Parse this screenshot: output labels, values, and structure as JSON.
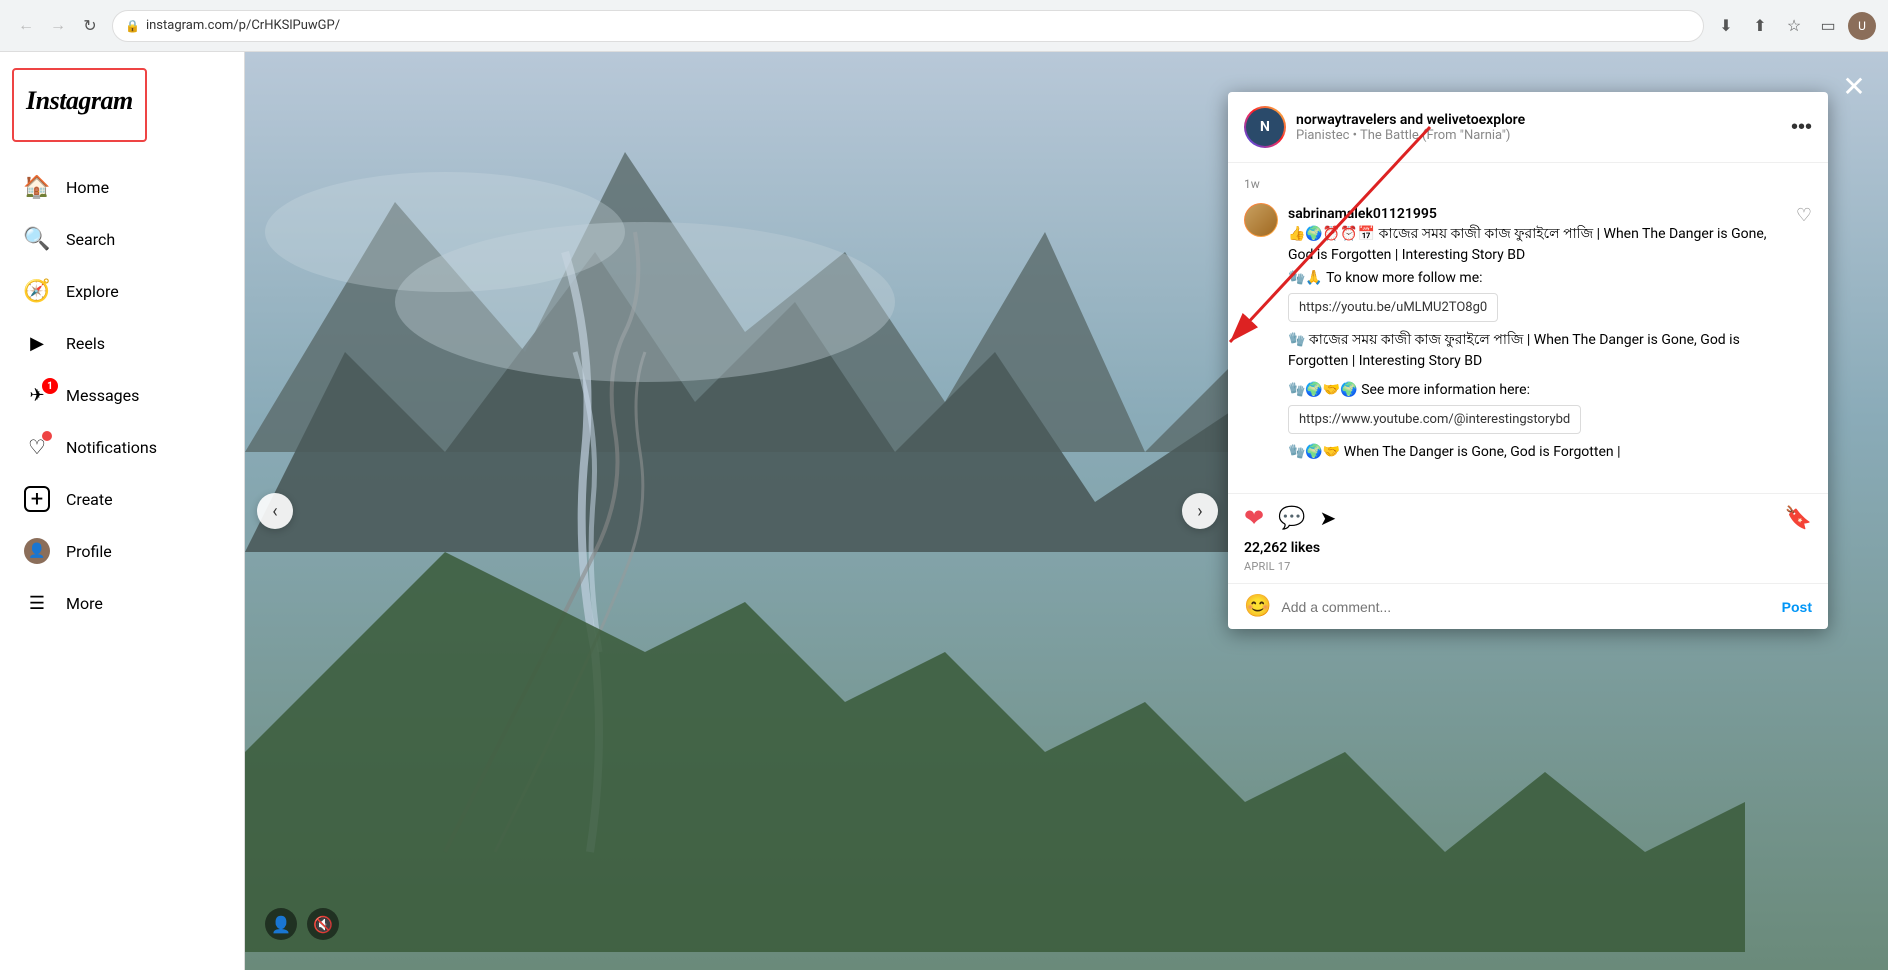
{
  "browser": {
    "back_label": "←",
    "forward_label": "→",
    "reload_label": "↻",
    "url": "instagram.com/p/CrHKSlPuwGP/",
    "download_title": "Download",
    "share_title": "Share",
    "bookmark_title": "Bookmark",
    "tablet_title": "Tablet mode",
    "profile_initial": "U"
  },
  "sidebar": {
    "logo": "Instagram",
    "nav_items": [
      {
        "id": "home",
        "label": "Home",
        "icon": "🏠"
      },
      {
        "id": "search",
        "label": "Search",
        "icon": "🔍"
      },
      {
        "id": "explore",
        "label": "Explore",
        "icon": "🧭"
      },
      {
        "id": "reels",
        "label": "Reels",
        "icon": "🎬"
      },
      {
        "id": "messages",
        "label": "Messages",
        "icon": "✈",
        "badge": "1"
      },
      {
        "id": "notifications",
        "label": "Notifications",
        "icon": "♡"
      },
      {
        "id": "create",
        "label": "Create",
        "icon": "⊕"
      },
      {
        "id": "profile",
        "label": "Profile",
        "icon": "👤"
      },
      {
        "id": "more",
        "label": "More",
        "icon": "☰"
      }
    ]
  },
  "post": {
    "username": "norwaytravelers and welivetoexplore",
    "subtitle": "Pianistec • The Battle (From \"Narnia\")",
    "timestamp": "1w",
    "more_options": "•••",
    "comment": {
      "username": "sabrinamalek01121995",
      "emojis": "👍🌍⏰⏰📅",
      "text_bengali": "কাজের সময় কাজী কাজ ফুরাইলে পাজি | When The Danger is Gone, God is Forgotten | Interesting Story BD",
      "follow_text": "🧤🙏 To know more follow me:",
      "link1": "https://youtu.be/uMLMU2TO8g0",
      "more_bengali": "🧤 কাজের সময় কাজী কাজ ফুরাইলে পাজি | When The Danger is Gone, God is Forgotten | Interesting Story BD",
      "see_more": "🧤🌍🤝🌍 See more information here:",
      "link2": "https://www.youtube.com/@interestingstorybd",
      "truncated": "🧤🌍🤝 When The Danger is Gone, God is Forgotten |"
    },
    "actions": {
      "like_icon": "❤",
      "comment_icon": "💬",
      "share_icon": "➤",
      "save_icon": "🔖",
      "likes_count": "22,262 likes",
      "date": "APRIL 17"
    },
    "comment_input": {
      "placeholder": "Add a comment...",
      "post_label": "Post",
      "emoji_icon": "😊"
    }
  },
  "close_btn": "✕",
  "nav_left": "‹",
  "nav_right": "›"
}
